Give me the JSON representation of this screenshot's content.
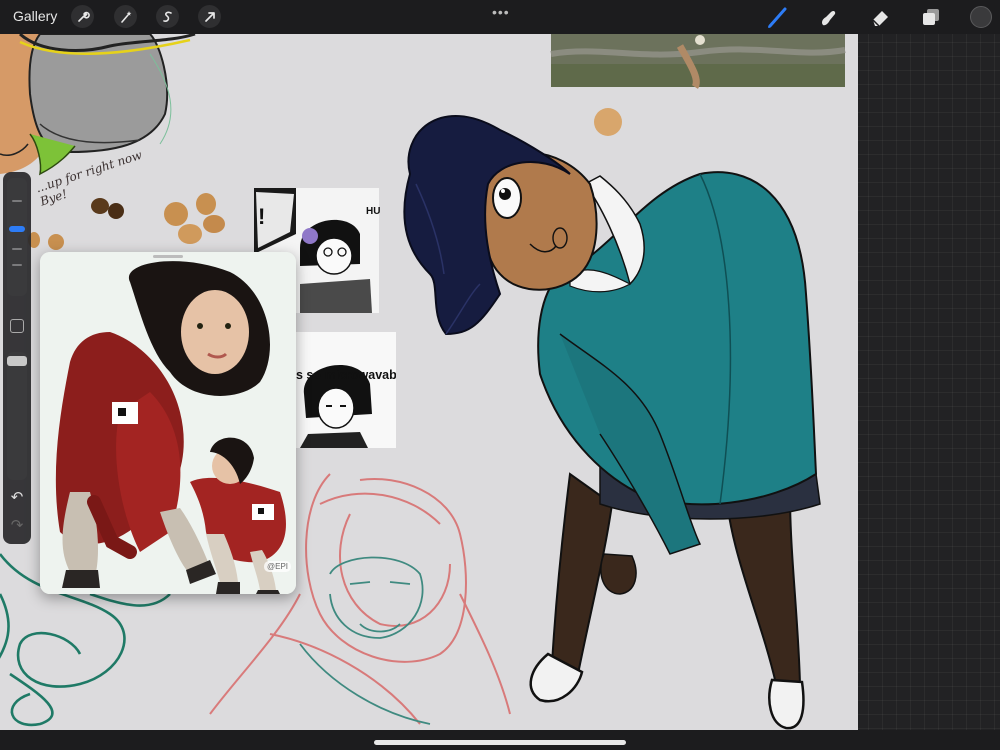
{
  "app": {
    "gallery_label": "Gallery",
    "more_dots": "•••",
    "current_color": "#3a3a3c",
    "accent_color": "#2d7cf6"
  },
  "toolbar": {
    "left_tools": [
      "wrench-icon",
      "magic-wand-icon",
      "selection-icon",
      "transform-arrow-icon"
    ],
    "right_tools": [
      "brush-icon",
      "smudge-icon",
      "eraser-icon",
      "layers-icon",
      "color-icon"
    ],
    "active_tool": "brush-icon"
  },
  "sidebar": {
    "brush_size_level": 0.55,
    "opacity_level": 0.95,
    "undo_icon": "undo-icon",
    "redo_icon": "redo-icon"
  },
  "reference": {
    "watermark": "@EPI"
  },
  "canvas_text": {
    "sketch_note": "...up for right now\nBye!",
    "manga_caption": "s so microwavable",
    "manga_sfx_left": "!",
    "manga_sfx_right": "HU"
  }
}
